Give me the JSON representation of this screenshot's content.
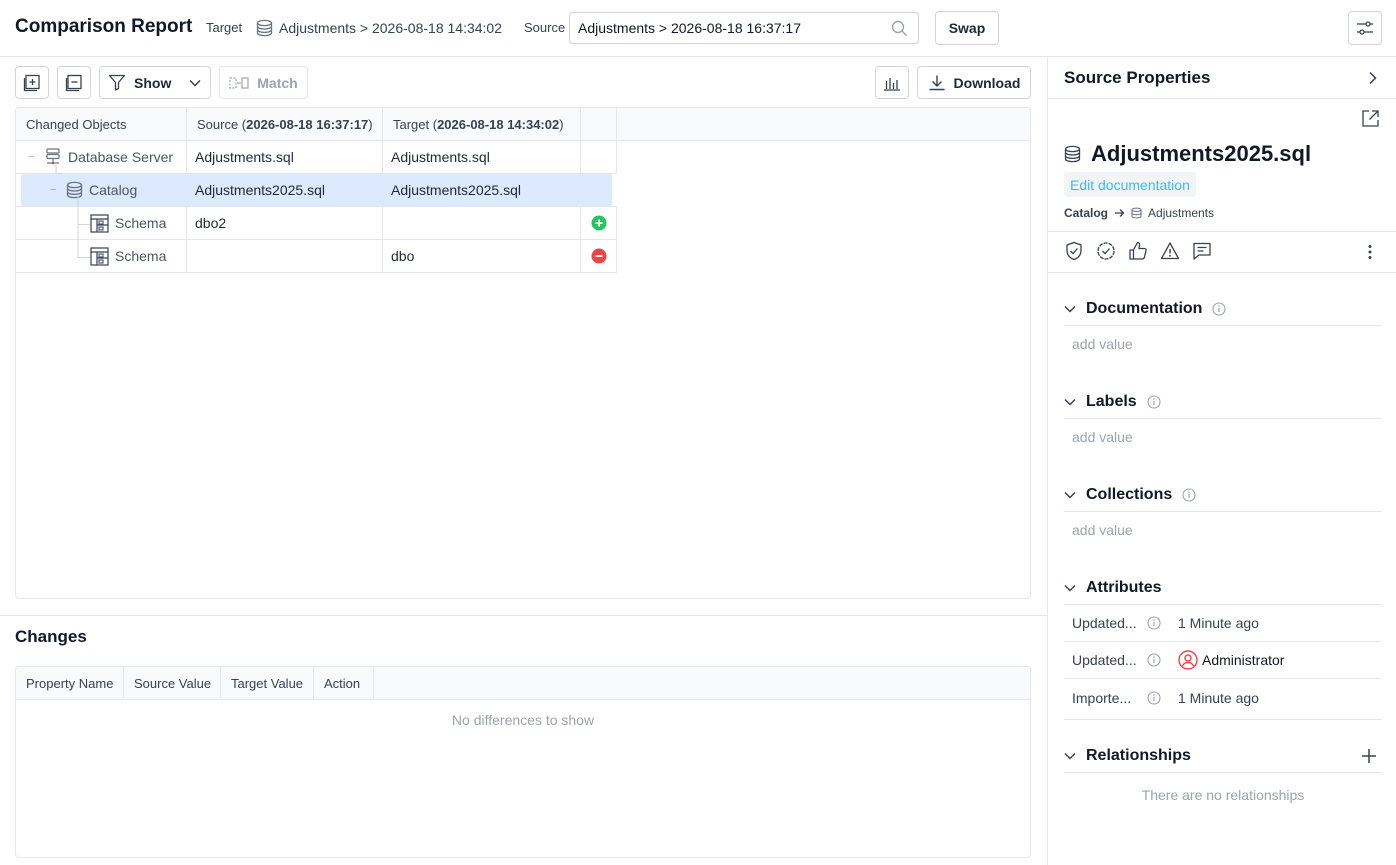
{
  "header": {
    "title": "Comparison Report",
    "target_label": "Target",
    "target_value": "Adjustments > 2026-08-18 14:34:02",
    "source_label": "Source",
    "source_value": "Adjustments > 2026-08-18 16:37:17",
    "swap_label": "Swap"
  },
  "toolbar": {
    "show_label": "Show",
    "match_label": "Match",
    "download_label": "Download"
  },
  "tree": {
    "columns": {
      "changed_objects": "Changed Objects",
      "source_prefix": "Source (",
      "source_date": "2026-08-18 16:37:17",
      "source_suffix": ")",
      "target_prefix": "Target (",
      "target_date": "2026-08-18 14:34:02",
      "target_suffix": ")"
    },
    "rows": [
      {
        "name": "Database Server",
        "source": "Adjustments.sql",
        "target": "Adjustments.sql",
        "collapse": "−"
      },
      {
        "name": "Catalog",
        "source": "Adjustments2025.sql",
        "target": "Adjustments2025.sql",
        "collapse": "−"
      },
      {
        "name": "Schema",
        "source": "dbo2",
        "target": "",
        "status": "added"
      },
      {
        "name": "Schema",
        "source": "",
        "target": "dbo",
        "status": "removed"
      }
    ]
  },
  "changes": {
    "title": "Changes",
    "columns": [
      "Property Name",
      "Source Value",
      "Target Value",
      "Action"
    ],
    "empty": "No differences to show"
  },
  "panel": {
    "title": "Source Properties",
    "object_name": "Adjustments2025.sql",
    "edit_doc": "Edit documentation",
    "crumb_parent": "Catalog",
    "crumb_child": "Adjustments",
    "sections": {
      "documentation": "Documentation",
      "labels": "Labels",
      "collections": "Collections",
      "attributes": "Attributes",
      "relationships": "Relationships"
    },
    "add_value": "add value",
    "attributes": [
      {
        "key": "Updated...",
        "value": "1 Minute ago"
      },
      {
        "key": "Updated...",
        "value": "Administrator"
      },
      {
        "key": "Importe...",
        "value": "1 Minute ago"
      }
    ],
    "no_relationships": "There are no relationships"
  },
  "colors": {
    "added": "#22c55e",
    "removed": "#ef4444",
    "selected_row": "#dbeafe",
    "link": "#38bdf8"
  }
}
